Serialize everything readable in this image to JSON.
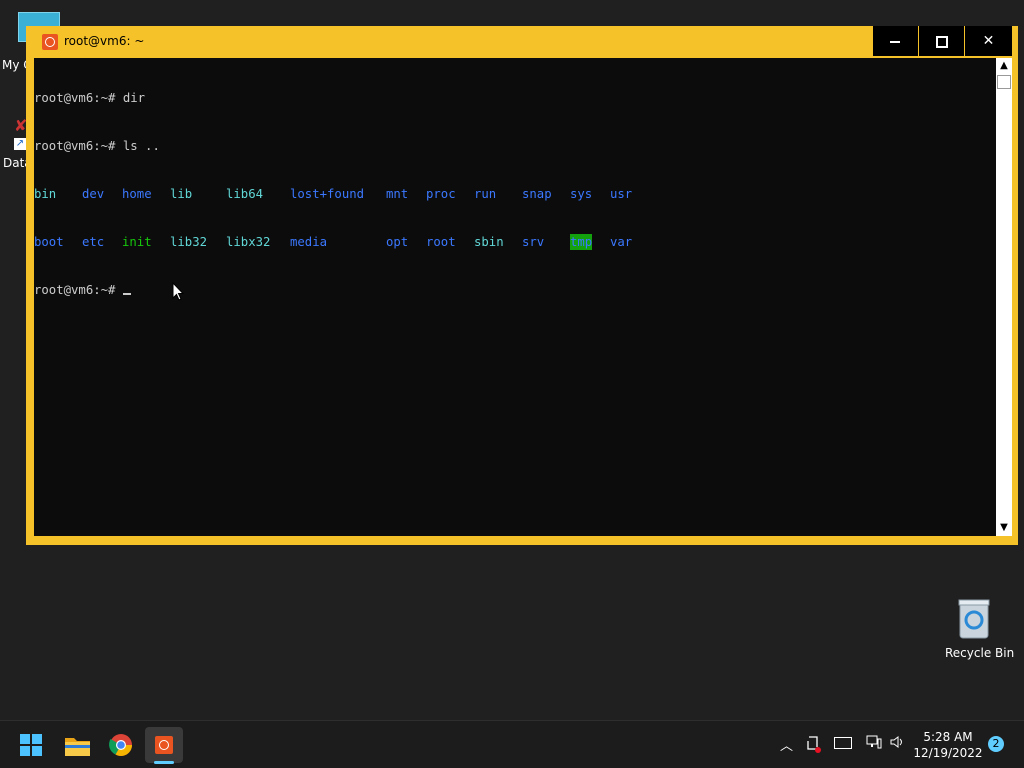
{
  "desktop": {
    "my_computer_label": "My C",
    "data_shortcut_label": "Data",
    "recycle_bin_label": "Recycle Bin"
  },
  "window": {
    "title": "root@vm6: ~",
    "icon": "ubuntu-icon",
    "minimize_icon": "minimize-icon",
    "maximize_icon": "maximize-icon",
    "close_glyph": "✕"
  },
  "terminal": {
    "line1": "root@vm6:~# dir",
    "line2": "root@vm6:~# ls ..",
    "row1": [
      "bin",
      "dev",
      "home",
      "lib",
      "lib64",
      "lost+found",
      "mnt",
      "proc",
      "run",
      "snap",
      "sys",
      "usr"
    ],
    "row2": [
      "boot",
      "etc",
      "init",
      "lib32",
      "libx32",
      "media",
      "opt",
      "root",
      "sbin",
      "srv",
      "tmp",
      "var"
    ],
    "prompt": "root@vm6:~# "
  },
  "taskbar": {
    "start_icon": "windows-start-icon",
    "explorer_icon": "file-explorer-icon",
    "chrome_icon": "chrome-icon",
    "terminal_icon": "ubuntu-terminal-icon",
    "time": "5:28 AM",
    "date": "12/19/2022",
    "notification_count": "2"
  },
  "colors": {
    "window_frame": "#f5c22a",
    "console_bg": "#0c0c0c",
    "dir_blue": "#3b78ff",
    "exec_green": "#16c60c",
    "link_cyan": "#61d6d6",
    "tmp_highlight": "#13a10e"
  }
}
